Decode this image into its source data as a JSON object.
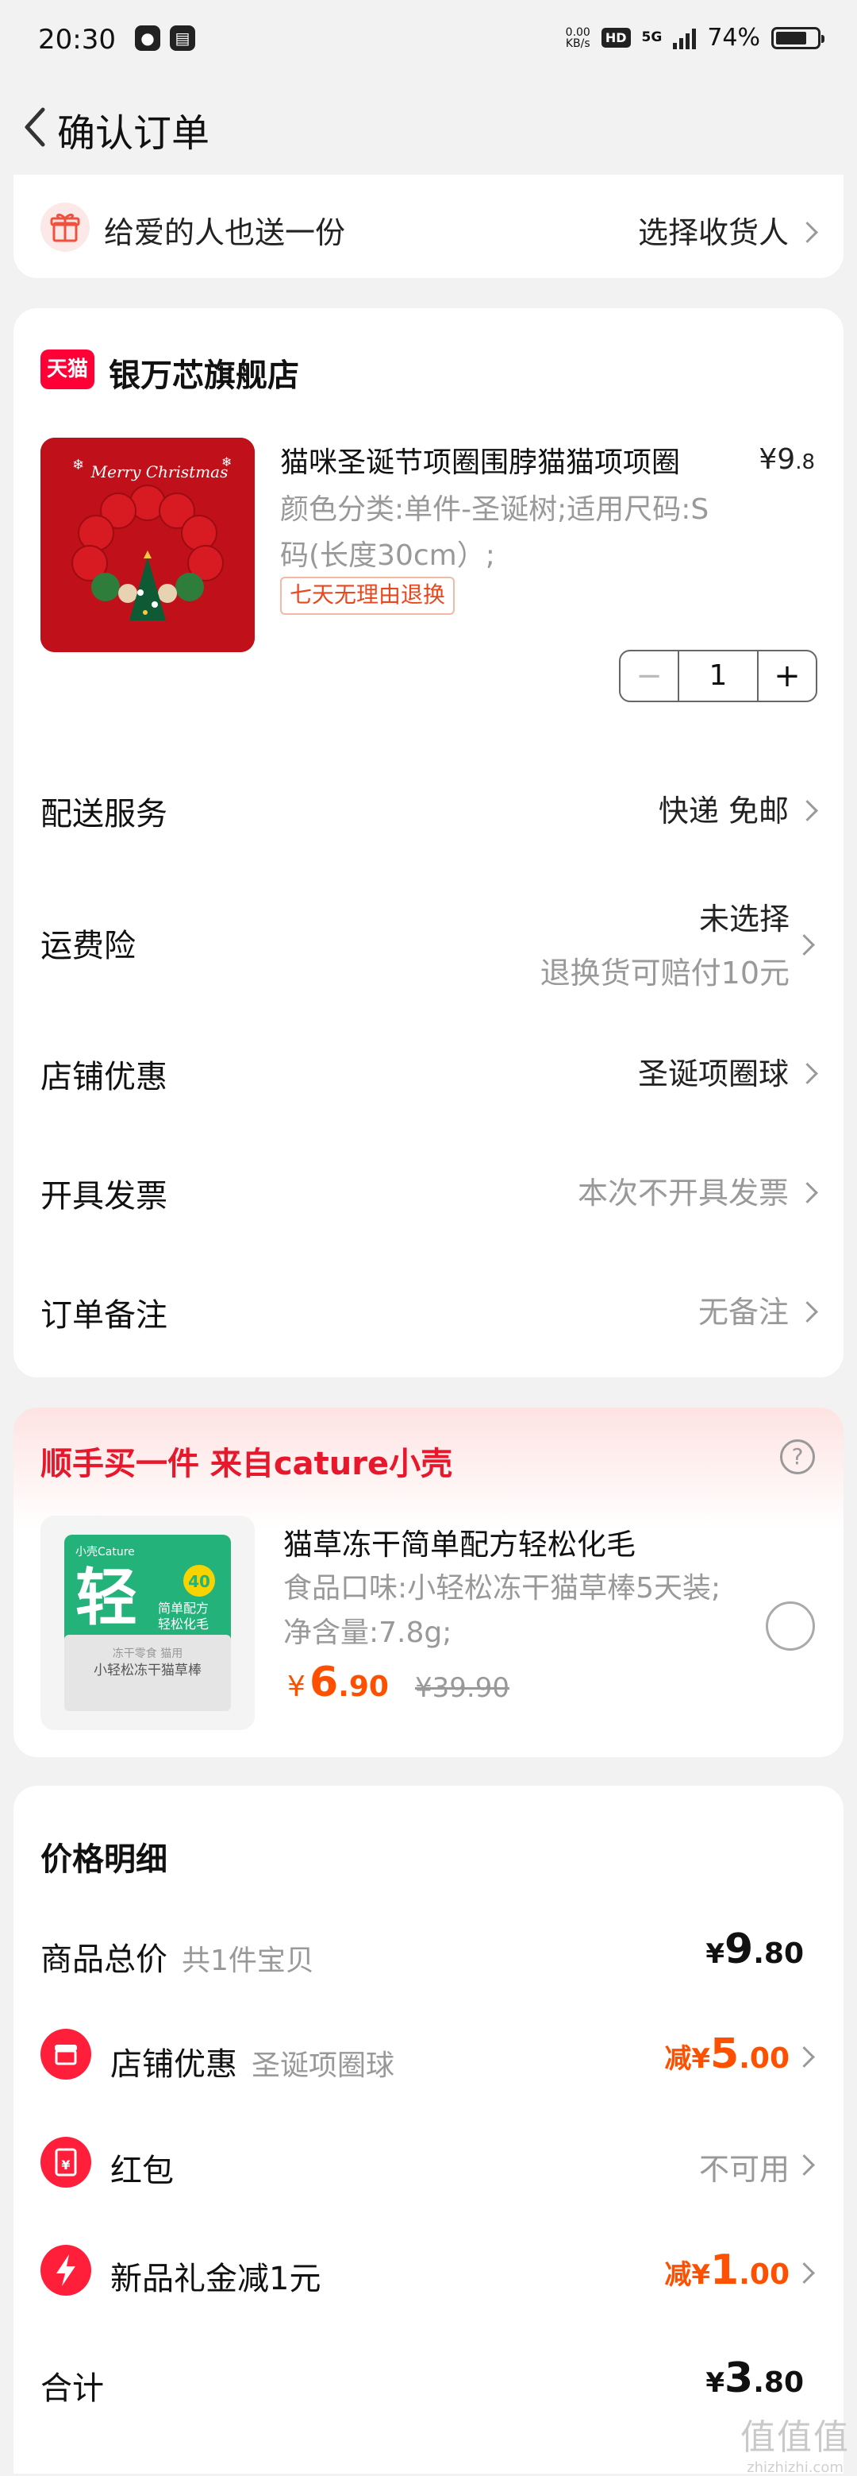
{
  "status_bar": {
    "time": "20:30",
    "net_speed_value": "0.00",
    "net_speed_unit": "KB/s",
    "hd": "HD",
    "network": "5G",
    "battery": "74%"
  },
  "nav": {
    "title": "确认订单"
  },
  "gift": {
    "label": "给爱的人也送一份",
    "action": "选择收货人"
  },
  "store": {
    "badge": "天猫",
    "name": "银万芯旗舰店"
  },
  "product": {
    "title": "猫咪圣诞节项圈围脖猫猫项项圈",
    "price_yen": "¥",
    "price_int": "9",
    "price_dec": ".8",
    "spec": "颜色分类:单件-圣诞树;适用尺码:S码(长度30cm）;",
    "tag": "七天无理由退换",
    "image_text": "Merry Christmas",
    "quantity": "1"
  },
  "rows": {
    "delivery": {
      "label": "配送服务",
      "value": "快递 免邮"
    },
    "insurance": {
      "label": "运费险",
      "value": "未选择",
      "sub": "退换货可赔付10元"
    },
    "discount": {
      "label": "店铺优惠",
      "value": "圣诞项圈球"
    },
    "invoice": {
      "label": "开具发票",
      "value": "本次不开具发票"
    },
    "note": {
      "label": "订单备注",
      "value": "无备注"
    }
  },
  "recommend": {
    "title": "顺手买一件  来自cature小壳",
    "help": "?",
    "name": "猫草冻干简单配方轻松化毛",
    "spec": "食品口味:小轻松冻干猫草棒5天装;净含量:7.8g;",
    "price_yen": "¥",
    "price_int": "6",
    "price_dec": ".90",
    "orig_price": "¥39.90",
    "pack_brand": "小壳Cature",
    "pack_big": "轻",
    "pack_badge": "40",
    "pack_line1": "简单配方",
    "pack_line2": "轻松化毛",
    "pack_line3": "冻干零食 猫用",
    "pack_line4": "小轻松冻干猫草棒"
  },
  "price_detail": {
    "title": "价格明细",
    "total_goods": {
      "label": "商品总价",
      "sub": "共1件宝贝",
      "yen": "¥",
      "int": "9",
      "dec": ".80"
    },
    "store_discount": {
      "label": "店铺优惠",
      "sub": "圣诞项圈球",
      "prefix": "减",
      "yen": "¥",
      "int": "5",
      "dec": ".00"
    },
    "red_packet": {
      "label": "红包",
      "value": "不可用",
      "glyph": "¥"
    },
    "new_gift": {
      "label": "新品礼金减1元",
      "prefix": "减",
      "yen": "¥",
      "int": "1",
      "dec": ".00"
    },
    "sum": {
      "label": "合计",
      "yen": "¥",
      "int": "3",
      "dec": ".80"
    }
  },
  "watermark": {
    "big": "值值值",
    "small": "zhizhizhi.com"
  },
  "colors": {
    "accent": "#ff5000",
    "tmall_red": "#ff0036",
    "title_red": "#e8182c",
    "icon_red": "#ff1f3a"
  }
}
